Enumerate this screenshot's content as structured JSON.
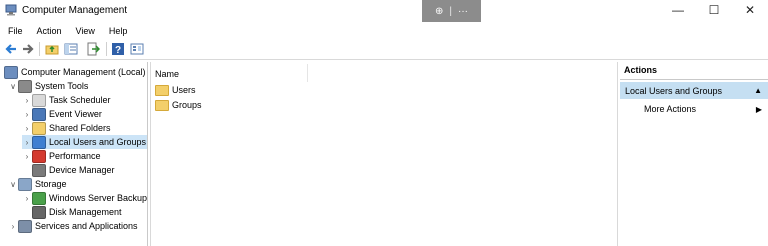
{
  "window": {
    "title": "Computer Management",
    "zoom_icon": "⊕",
    "more_icon": "···",
    "minimize_glyph": "—",
    "maximize_glyph": "☐",
    "close_glyph": "✕"
  },
  "menu": [
    "File",
    "Action",
    "View",
    "Help"
  ],
  "toolbar": {
    "icons": [
      "back-arrow-icon",
      "forward-arrow-icon",
      "up-folder-icon",
      "show-hide-tree-icon",
      "export-list-icon",
      "help-icon",
      "properties-icon"
    ]
  },
  "tree": [
    {
      "label": "Computer Management (Local)",
      "chevron": "",
      "icon": "computer-management-icon",
      "level": 0
    },
    {
      "label": "System Tools",
      "chevron": "∨",
      "icon": "system-tools-icon",
      "level": 1
    },
    {
      "label": "Task Scheduler",
      "chevron": "›",
      "icon": "task-scheduler-icon",
      "level": 2
    },
    {
      "label": "Event Viewer",
      "chevron": "›",
      "icon": "event-viewer-icon",
      "level": 2
    },
    {
      "label": "Shared Folders",
      "chevron": "›",
      "icon": "shared-folders-icon",
      "level": 2
    },
    {
      "label": "Local Users and Groups",
      "chevron": "›",
      "icon": "local-users-groups-icon",
      "level": 2,
      "selected": true
    },
    {
      "label": "Performance",
      "chevron": "›",
      "icon": "performance-icon",
      "level": 2
    },
    {
      "label": "Device Manager",
      "chevron": "",
      "icon": "device-manager-icon",
      "level": 2
    },
    {
      "label": "Storage",
      "chevron": "∨",
      "icon": "storage-icon",
      "level": 1
    },
    {
      "label": "Windows Server Backup",
      "chevron": "›",
      "icon": "windows-server-backup-icon",
      "level": 2
    },
    {
      "label": "Disk Management",
      "chevron": "",
      "icon": "disk-management-icon",
      "level": 2
    },
    {
      "label": "Services and Applications",
      "chevron": "›",
      "icon": "services-applications-icon",
      "level": 1
    }
  ],
  "list": {
    "column_name": "Name",
    "items": [
      "Users",
      "Groups"
    ]
  },
  "actions": {
    "header": "Actions",
    "section_label": "Local Users and Groups",
    "section_glyph": "▲",
    "more_label": "More Actions",
    "more_glyph": "▶"
  }
}
